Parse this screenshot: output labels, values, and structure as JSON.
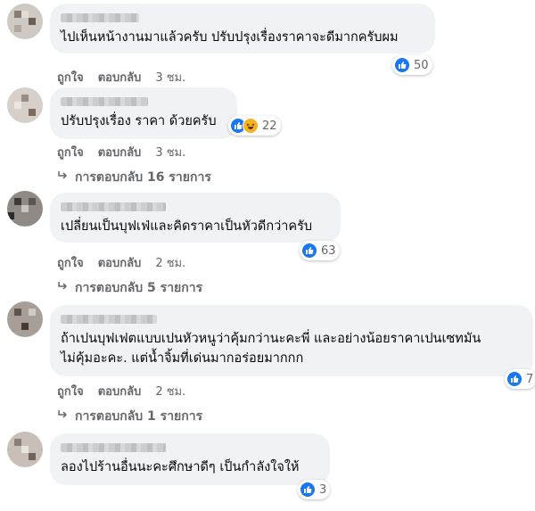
{
  "comments": [
    {
      "text": [
        "ไปเห็นหน้างานมาแล้วครับ ปรับปรุงเรื่องราคาจะดีมากครับผม"
      ],
      "like_label": "ถูกใจ",
      "reply_label": "ตอบกลับ",
      "time": "3 ชม.",
      "reaction_count": "50",
      "reactions": [
        "like-icon"
      ],
      "replies": ""
    },
    {
      "text": [
        "ปรับปรุงเรื่อง ราคา ด้วยครับ"
      ],
      "like_label": "ถูกใจ",
      "reply_label": "ตอบกลับ",
      "time": "3 ชม.",
      "reaction_count": "22",
      "reactions": [
        "like-icon",
        "haha-icon"
      ],
      "replies": "การตอบกลับ 16 รายการ"
    },
    {
      "text": [
        "เปลี่ยนเป็นบุฟเฟ่และคิดราคาเป็นหัวดีกว่าครับ"
      ],
      "like_label": "ถูกใจ",
      "reply_label": "ตอบกลับ",
      "time": "2 ชม.",
      "reaction_count": "63",
      "reactions": [
        "like-icon"
      ],
      "replies": "การตอบกลับ 5 รายการ"
    },
    {
      "text": [
        "ถ้าเปนบุฟเฟตแบบเปนหัวหนูว่าคุ้มกว่านะคะพี่ และอย่างน้อยราคาเปนเซทมัน",
        "ไม่คุ้มอะคะ. แต่น้ำจิ้มที่เด่นมากอร่อยมากกก"
      ],
      "like_label": "ถูกใจ",
      "reply_label": "ตอบกลับ",
      "time": "2 ชม.",
      "reaction_count": "7",
      "reactions": [
        "like-icon"
      ],
      "replies": "การตอบกลับ 1 รายการ"
    },
    {
      "text": [
        "ลองไปร้านอื่นนะคะศึกษาดีๆ เป็นกำลังใจให้"
      ],
      "like_label": "",
      "reply_label": "",
      "time": "",
      "reaction_count": "3",
      "reactions": [
        "like-icon"
      ],
      "replies": ""
    }
  ],
  "colors": {
    "bubble": "#f0f2f5",
    "secondary_text": "#65676b",
    "like_blue": "#1877f2",
    "haha_yellow": "#f7b125"
  }
}
